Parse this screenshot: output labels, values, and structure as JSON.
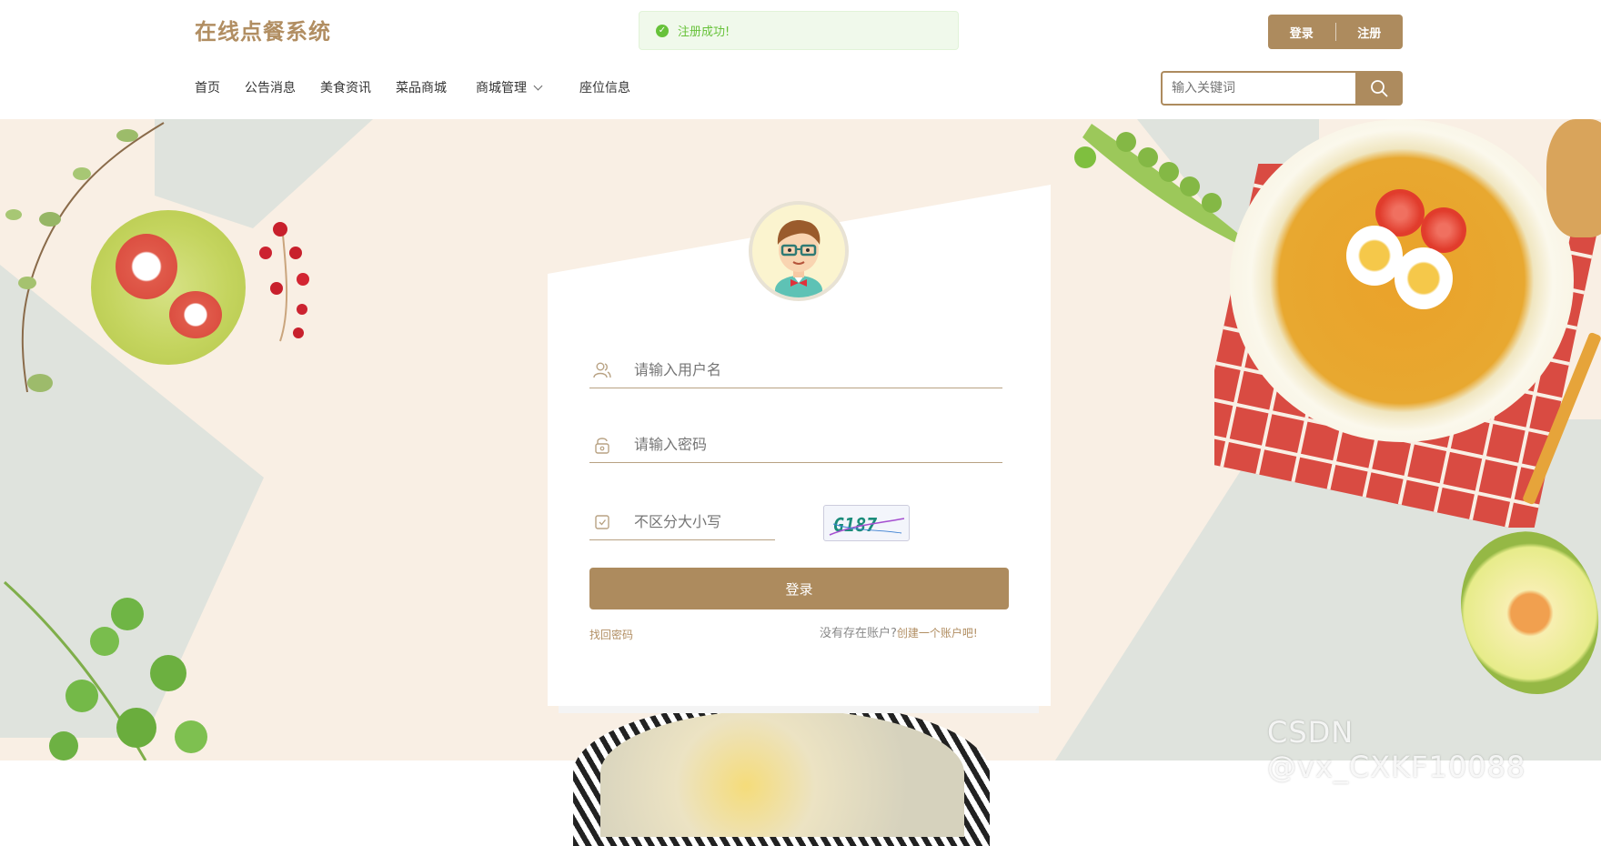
{
  "header": {
    "title": "在线点餐系统",
    "auth": {
      "login": "登录",
      "register": "注册"
    }
  },
  "toast": {
    "icon": "check-circle-icon",
    "message": "注册成功!"
  },
  "nav": {
    "items": [
      {
        "label": "首页"
      },
      {
        "label": "公告消息"
      },
      {
        "label": "美食资讯"
      },
      {
        "label": "菜品商城"
      },
      {
        "label": "商城管理",
        "has_dropdown": true
      },
      {
        "label": "座位信息"
      }
    ]
  },
  "search": {
    "placeholder": "输入关键词",
    "icon": "search-icon"
  },
  "login_form": {
    "username_placeholder": "请输入用户名",
    "password_placeholder": "请输入密码",
    "captcha_placeholder": "不区分大小写",
    "captcha_text": "G187",
    "submit": "登录",
    "forgot": "找回密码",
    "no_account": "没有存在账户?",
    "create_account": "创建一个账户吧!"
  },
  "watermark": "CSDN @vx_CXKF10088",
  "colors": {
    "accent": "#ad8b5e",
    "title": "#b18e62",
    "background": "#f9efe4",
    "toast_bg": "#f0f9eb",
    "toast_text": "#67c23a"
  }
}
